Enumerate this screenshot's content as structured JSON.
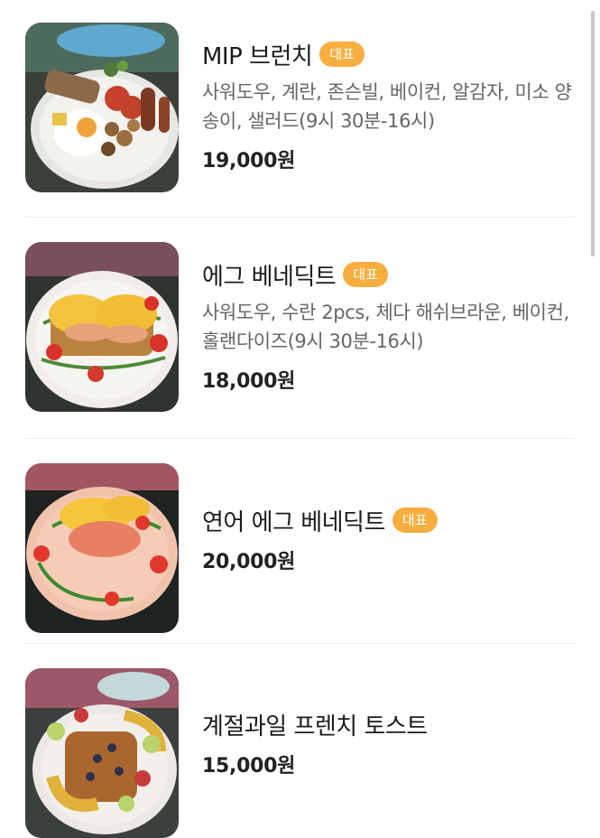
{
  "menu": {
    "items": [
      {
        "name": "MIP 브런치",
        "badge": "대표",
        "description": "사워도우, 계란, 존슨빌, 베이컨, 알감자, 미소 양송이, 샐러드(9시 30분-16시)",
        "price": "19,000원",
        "image_icon": "brunch-plate-image"
      },
      {
        "name": "에그 베네딕트",
        "badge": "대표",
        "description": "사워도우, 수란 2pcs, 체다 해쉬브라운, 베이컨, 홀랜다이즈(9시 30분-16시)",
        "price": "18,000원",
        "image_icon": "eggs-benedict-image"
      },
      {
        "name": "연어 에그 베네딕트",
        "badge": "대표",
        "description": "",
        "price": "20,000원",
        "image_icon": "salmon-eggs-benedict-image"
      },
      {
        "name": "계절과일 프렌치 토스트",
        "badge": "",
        "description": "",
        "price": "15,000원",
        "image_icon": "french-toast-image"
      }
    ]
  },
  "colors": {
    "badge_bg": "#f7ae3f",
    "title": "#1c1c1c",
    "description": "#666666",
    "price": "#222222",
    "divider": "#ececec"
  }
}
